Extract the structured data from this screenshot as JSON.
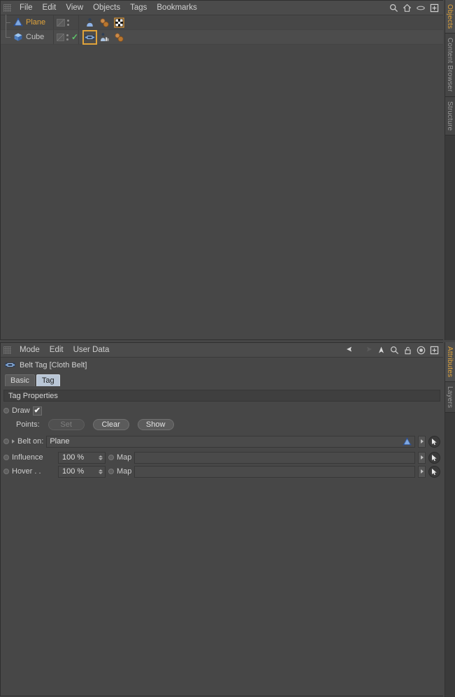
{
  "objects_panel": {
    "menu": [
      "File",
      "Edit",
      "View",
      "Objects",
      "Tags",
      "Bookmarks"
    ],
    "tools": [
      "search-icon",
      "home-icon",
      "ellipse-icon",
      "plus-box-icon"
    ],
    "rows": [
      {
        "name": "Plane",
        "object_icon": "plane-icon",
        "selected": true,
        "enabled_check": false,
        "tags": [
          "cloth-tag",
          "material-tag",
          "texture-checker-tag"
        ]
      },
      {
        "name": "Cube",
        "object_icon": "cube-icon",
        "selected": false,
        "enabled_check": true,
        "tags": [
          "cloth-belt-tag",
          "cloth-collider-tag",
          "material-tag"
        ]
      }
    ]
  },
  "right_tabs_top": [
    {
      "label": "Objects",
      "active": true
    },
    {
      "label": "Content Browser",
      "active": false
    },
    {
      "label": "Structure",
      "active": false
    }
  ],
  "right_tabs_bottom": [
    {
      "label": "Attributes",
      "active": true
    },
    {
      "label": "Layers",
      "active": false
    }
  ],
  "attributes_panel": {
    "menu": [
      "Mode",
      "Edit",
      "User Data"
    ],
    "tools": [
      "back-arrow-icon",
      "forward-arrow-icon",
      "up-arrow-icon",
      "search-icon",
      "lock-icon",
      "target-icon",
      "plus-box-icon"
    ],
    "object_title": "Belt Tag [Cloth Belt]",
    "object_icon": "cloth-belt-tag-icon",
    "tabs": [
      {
        "label": "Basic",
        "active": false
      },
      {
        "label": "Tag",
        "active": true
      }
    ],
    "section_title": "Tag Properties",
    "draw": {
      "label": "Draw",
      "checked": true,
      "checkmark": "✔"
    },
    "points": {
      "label": "Points:",
      "buttons": [
        {
          "label": "Set",
          "disabled": true
        },
        {
          "label": "Clear",
          "disabled": false
        },
        {
          "label": "Show",
          "disabled": false
        }
      ]
    },
    "belt_on": {
      "label": "Belt on:",
      "value": "Plane",
      "value_icon": "plane-icon"
    },
    "influence": {
      "label": "Influence",
      "value": "100 %",
      "map_label": "Map",
      "map_value": ""
    },
    "hover": {
      "label": "Hover . .",
      "value": "100 %",
      "map_label": "Map",
      "map_value": ""
    }
  },
  "colors": {
    "background": "#474747",
    "panel_header": "#4b4b4b",
    "accent_orange": "#e0a33a",
    "tab_active": "#b9c6d6",
    "check_green": "#5ec46a",
    "field_bg": "#4a4a4a"
  }
}
